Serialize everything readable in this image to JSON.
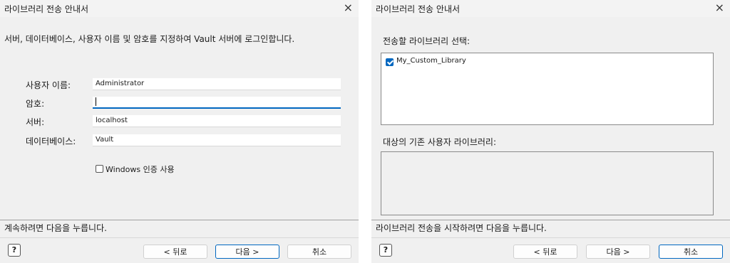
{
  "left": {
    "title": "라이브러리 전송 안내서",
    "close_glyph": "×",
    "instruction": "서버, 데이터베이스, 사용자 이름 및 암호를 지정하여 Vault 서버에 로그인합니다.",
    "fields": [
      {
        "label": "사용자 이름:",
        "value": "Administrator"
      },
      {
        "label": "암호:",
        "value": ""
      },
      {
        "label": "서버:",
        "value": "localhost"
      },
      {
        "label": "데이터베이스:",
        "value": "Vault"
      }
    ],
    "windows_auth_label": "Windows 인증 사용",
    "windows_auth_checked": false,
    "footer_text": "계속하려면 다음을 누릅니다.",
    "buttons": {
      "help": "?",
      "back": "< 뒤로",
      "next": "다음 >",
      "cancel": "취소"
    }
  },
  "right": {
    "title": "라이브러리 전송 안내서",
    "close_glyph": "×",
    "select_label": "전송할 라이브러리 선택:",
    "libraries": [
      {
        "name": "My_Custom_Library",
        "checked": true
      }
    ],
    "target_label": "대상의 기존 사용자 라이브러리:",
    "target_libraries": [],
    "footer_text": "라이브러리 전송을 시작하려면 다음을 누릅니다.",
    "buttons": {
      "help": "?",
      "back": "< 뒤로",
      "next": "다음 >",
      "cancel": "취소"
    }
  },
  "colors": {
    "accent": "#0067c0",
    "dialog_bg": "#f0f0f0"
  },
  "icons": {
    "close": "close-icon",
    "help": "help-icon"
  }
}
